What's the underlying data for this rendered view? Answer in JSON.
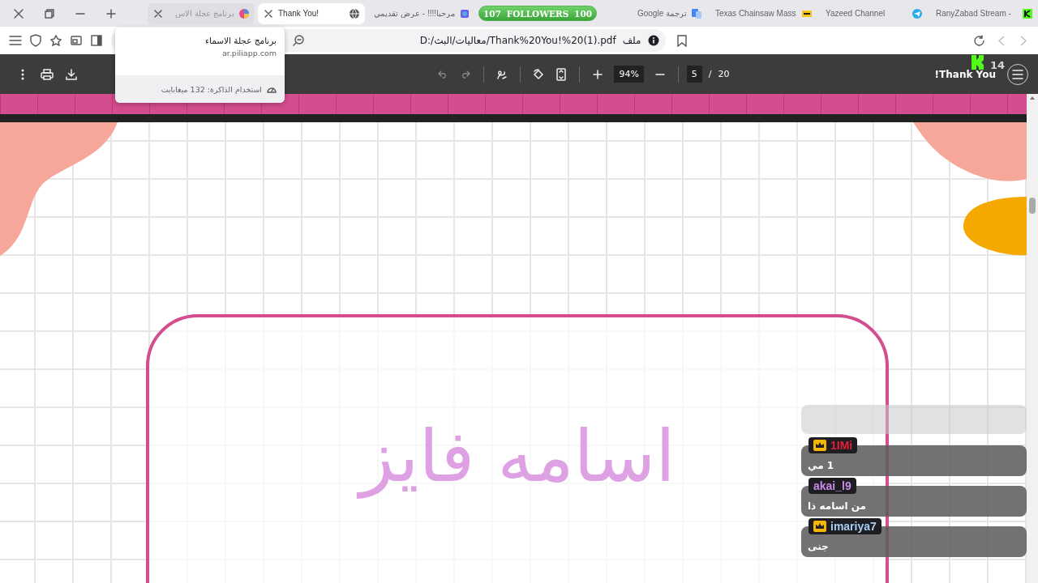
{
  "tabs": [
    {
      "title": "RanyZabad Stream -",
      "selected": false,
      "hovered": false
    },
    {
      "title": "Yazeed Channel",
      "selected": false,
      "hovered": false
    },
    {
      "title": "Texas Chainsaw Mass",
      "selected": false,
      "hovered": false
    },
    {
      "title": "ترجمة Google",
      "selected": false,
      "hovered": false
    },
    {
      "title": "مرحبا!!!! - عرض تقديمي",
      "selected": false,
      "hovered": false
    },
    {
      "title": "Thank You!",
      "selected": true,
      "hovered": false
    },
    {
      "title": "برنامج عجلة الاس",
      "selected": false,
      "hovered": true
    }
  ],
  "followers_goal": {
    "current": "107",
    "label": "FOLLOWERS",
    "target": "100"
  },
  "address_bar": {
    "scheme_label": "ملف",
    "url": "D:/معاليات/البث/Thank%20You!%20(1).pdf"
  },
  "tab_tooltip": {
    "title": "برنامج عجلة الاسماء",
    "url": "ar.piliapp.com",
    "memory": "استخدام الذاكرة: 132 ميغابايت"
  },
  "stream_overlay": {
    "viewer_count": "14"
  },
  "pdf_toolbar": {
    "title": "Thank You!",
    "zoom": "94%",
    "page": "5",
    "page_separator": "/",
    "page_count": "20"
  },
  "slide": {
    "name": "اسامه فايز"
  },
  "chat": [
    {
      "user": "1IMi",
      "color": "#e0203a",
      "crowned": true,
      "message": "1 مي"
    },
    {
      "user": "akai_l9",
      "color": "#c98ae8",
      "crowned": false,
      "message": "من اسامه ذا"
    },
    {
      "user": "imariya7",
      "color": "#a9cdf2",
      "crowned": true,
      "message": "جنى"
    }
  ]
}
